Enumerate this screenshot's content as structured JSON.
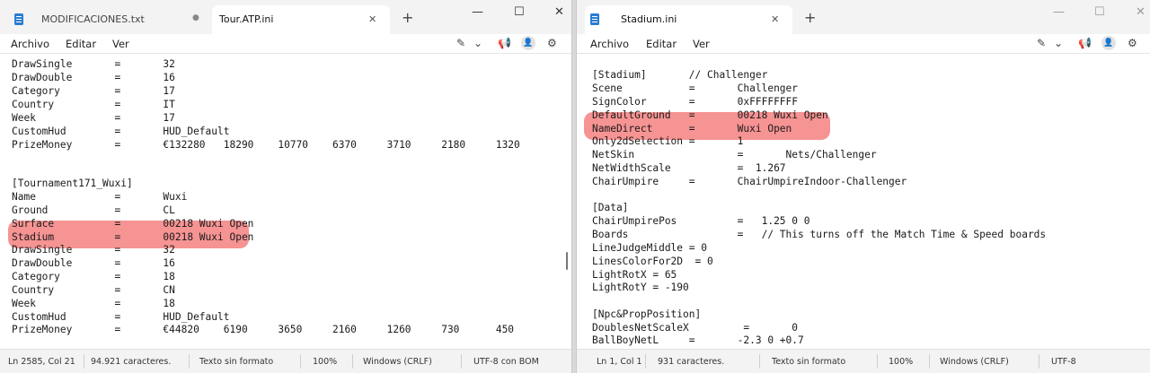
{
  "left": {
    "tabs": [
      {
        "label": "MODIFICACIONES.txt",
        "dot": "●"
      },
      {
        "label": "Tour.ATP.ini",
        "close": "✕"
      }
    ],
    "menu": [
      "Archivo",
      "Editar",
      "Ver"
    ],
    "lines": [
      "DrawSingle       =       32",
      "DrawDouble       =       16",
      "Category         =       17",
      "Country          =       IT",
      "Week             =       17",
      "CustomHud        =       HUD_Default",
      "PrizeMoney       =       €132280   18290    10770    6370     3710     2180     1320",
      "",
      "",
      "[Tournament171_Wuxi]",
      "Name             =       Wuxi",
      "Ground           =       CL",
      "Surface          =       00218 Wuxi Open",
      "Stadium          =       00218 Wuxi Open",
      "DrawSingle       =       32",
      "DrawDouble       =       16",
      "Category         =       18",
      "Country          =       CN",
      "Week             =       18",
      "CustomHud        =       HUD_Default",
      "PrizeMoney       =       €44820    6190     3650     2160     1260     730      450"
    ],
    "status": [
      "Ln 2585, Col 21",
      "94.921 caracteres.",
      "Texto sin formato",
      "100%",
      "Windows (CRLF)",
      "UTF-8 con BOM"
    ]
  },
  "right": {
    "tabs": [
      {
        "label": "Stadium.ini",
        "close": "✕"
      }
    ],
    "menu": [
      "Archivo",
      "Editar",
      "Ver"
    ],
    "lines": [
      "[Stadium]       // Challenger",
      "Scene           =       Challenger",
      "SignColor       =       0xFFFFFFFF",
      "DefaultGround   =       00218 Wuxi Open",
      "NameDirect      =       Wuxi Open",
      "Only2dSelection =       1",
      "NetSkin                 =       Nets/Challenger",
      "NetWidthScale           =  1.267",
      "ChairUmpire     =       ChairUmpireIndoor-Challenger",
      "",
      "[Data]",
      "ChairUmpirePos          =   1.25 0 0",
      "Boards                  =   // This turns off the Match Time & Speed boards",
      "LineJudgeMiddle = 0",
      "LinesColorFor2D  = 0",
      "LightRotX = 65",
      "LightRotY = -190",
      "",
      "[Npc&PropPosition]",
      "DoublesNetScaleX         =       0",
      "BallBoyNetL     =       -2.3 0 +0.7"
    ],
    "status": [
      "Ln 1, Col 1",
      "931 caracteres.",
      "Texto sin formato",
      "100%",
      "Windows (CRLF)",
      "UTF-8"
    ]
  },
  "icons": {
    "new_tab": "+",
    "minimize": "—",
    "maximize": "☐",
    "close": "✕",
    "copilot_icon": "✎",
    "chevron_down_icon": "⌄",
    "announce_icon": "📢",
    "account_icon": "👤",
    "settings_icon": "⚙"
  },
  "colors": {
    "highlight": "#f05050",
    "doc_icon": "#2b7cd3",
    "titlebar": "#f3f3f3"
  }
}
